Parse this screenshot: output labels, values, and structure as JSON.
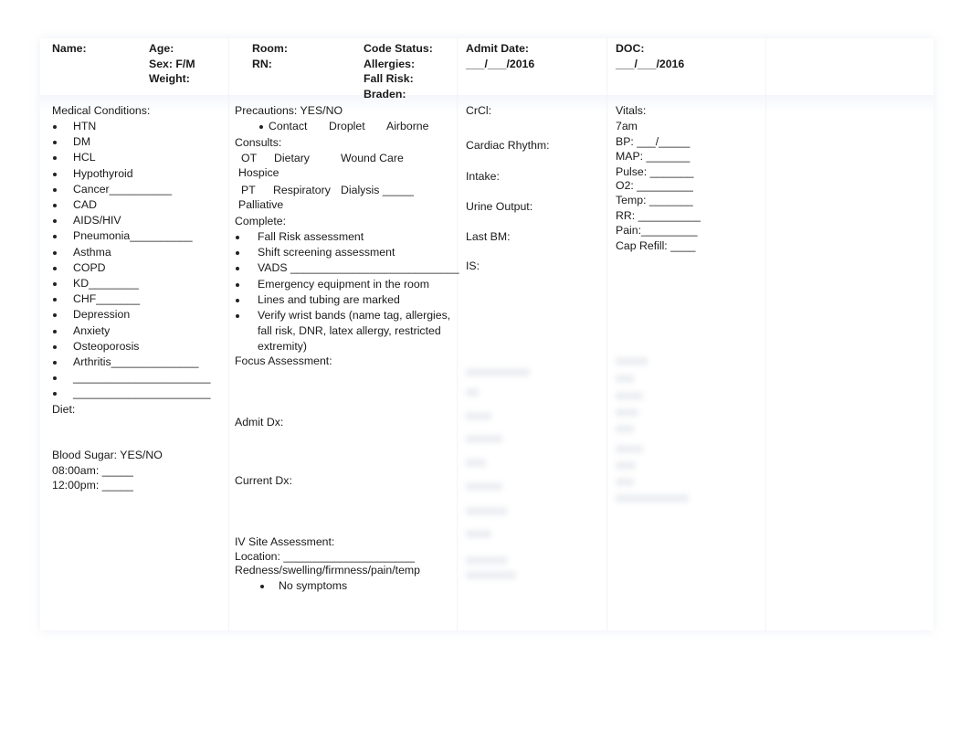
{
  "header": {
    "name": "Name:",
    "age": "Age:",
    "sex": "Sex: F/M",
    "weight": "Weight:",
    "room": "Room:",
    "rn": "RN:",
    "code_status": "Code Status:",
    "allergies": "Allergies:",
    "fall_risk": "Fall Risk:",
    "braden": "Braden:",
    "admit_date": "Admit Date:",
    "admit_date_value": "___/___/2016",
    "doc": "DOC:",
    "doc_value": "___/___/2016"
  },
  "col1": {
    "title": "Medical Conditions:",
    "conditions": [
      "HTN",
      "DM",
      "HCL",
      "Hypothyroid",
      "Cancer__________",
      "CAD",
      "AIDS/HIV",
      "Pneumonia__________",
      "Asthma",
      "COPD",
      "KD________",
      "CHF_______",
      "Depression",
      "Anxiety",
      "Osteoporosis",
      "Arthritis______________",
      "______________________",
      "______________________"
    ],
    "diet": "Diet:",
    "blood_sugar": "Blood Sugar: YES/NO",
    "bs_0800": "08:00am: _____",
    "bs_1200": "12:00pm: _____"
  },
  "col2": {
    "precautions": "Precautions: YES/NO",
    "precaution_options": [
      "Contact",
      "Droplet",
      "Airborne"
    ],
    "consults": "Consults:",
    "consult_row1": [
      "OT",
      "Dietary",
      "Wound Care"
    ],
    "consult_hospice": "Hospice",
    "consult_row2": [
      "PT",
      "Respiratory",
      "Dialysis _____"
    ],
    "consult_palliative": "Palliative",
    "complete": "Complete:",
    "complete_items": [
      "Fall Risk assessment",
      "Shift screening assessment",
      "VADS ___________________________",
      "Emergency equipment in the room",
      "Lines and tubing are marked",
      "Verify wrist bands (name tag, allergies,"
    ],
    "complete_cont": [
      "fall risk, DNR, latex allergy, restricted",
      "extremity)"
    ],
    "focus": "Focus Assessment:",
    "admit_dx": "Admit Dx:",
    "current_dx": "Current Dx:",
    "iv_site": "IV Site Assessment:",
    "location": "Location: _____________________",
    "redness": "Redness/swelling/firmness/pain/temp",
    "no_symptoms": "No symptoms"
  },
  "col3": {
    "items": [
      "CrCl:",
      "Cardiac Rhythm:",
      "Intake:",
      "Urine Output:",
      "Last BM:",
      "IS:"
    ]
  },
  "col4": {
    "title": "Vitals:",
    "time": "7am",
    "items": [
      "BP: ___/_____",
      "MAP: _______",
      "Pulse: _______",
      "O2: _________",
      "Temp: _______",
      "RR: __________",
      "Pain:_________",
      "Cap Refill: ____"
    ]
  }
}
